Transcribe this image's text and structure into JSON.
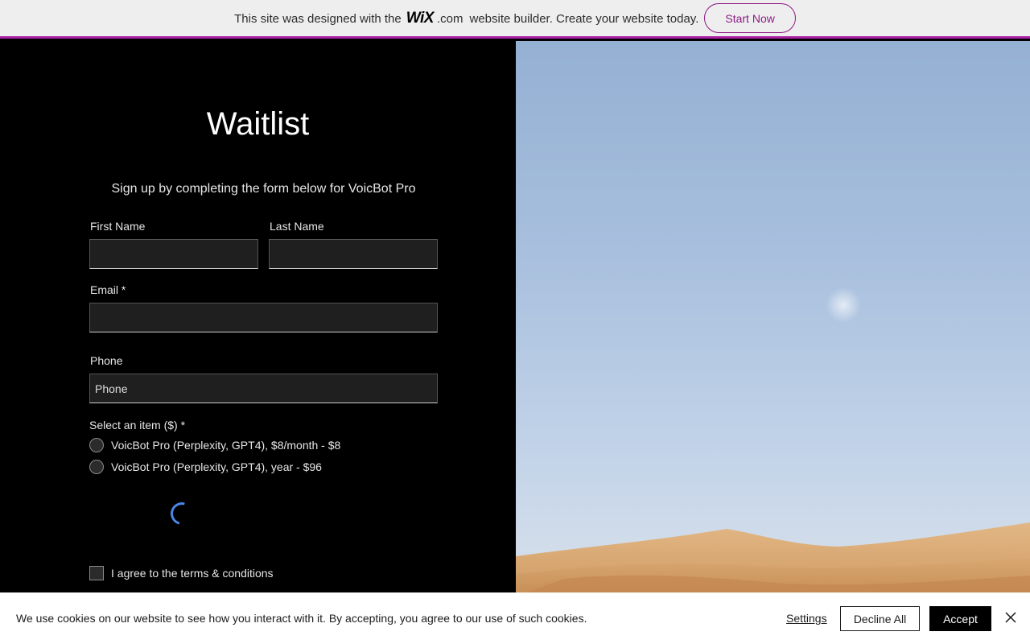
{
  "banner": {
    "text_before": "This site was designed with the",
    "logo": "WiX",
    "logo_suffix": ".com",
    "text_after": "website builder. Create your website today.",
    "button_label": "Start Now"
  },
  "form": {
    "title": "Waitlist",
    "subtitle": "Sign up by completing the form below for VoicBot Pro",
    "first_name_label": "First Name",
    "last_name_label": "Last Name",
    "email_label": "Email *",
    "phone_label": "Phone",
    "phone_placeholder": "Phone",
    "select_label": "Select an item ($) *",
    "options": [
      "VoicBot Pro (Perplexity, GPT4), $8/month - $8",
      "VoicBot Pro (Perplexity, GPT4), year - $96"
    ],
    "terms_label": "I agree to the terms & conditions"
  },
  "cookie": {
    "text": "We use cookies on our website to see how you interact with it. By accepting, you agree to our use of such cookies.",
    "settings_label": "Settings",
    "decline_label": "Decline All",
    "accept_label": "Accept"
  },
  "colors": {
    "banner_accent": "#a81fa1",
    "start_button": "#8e1b86",
    "spinner": "#4a86e8"
  }
}
